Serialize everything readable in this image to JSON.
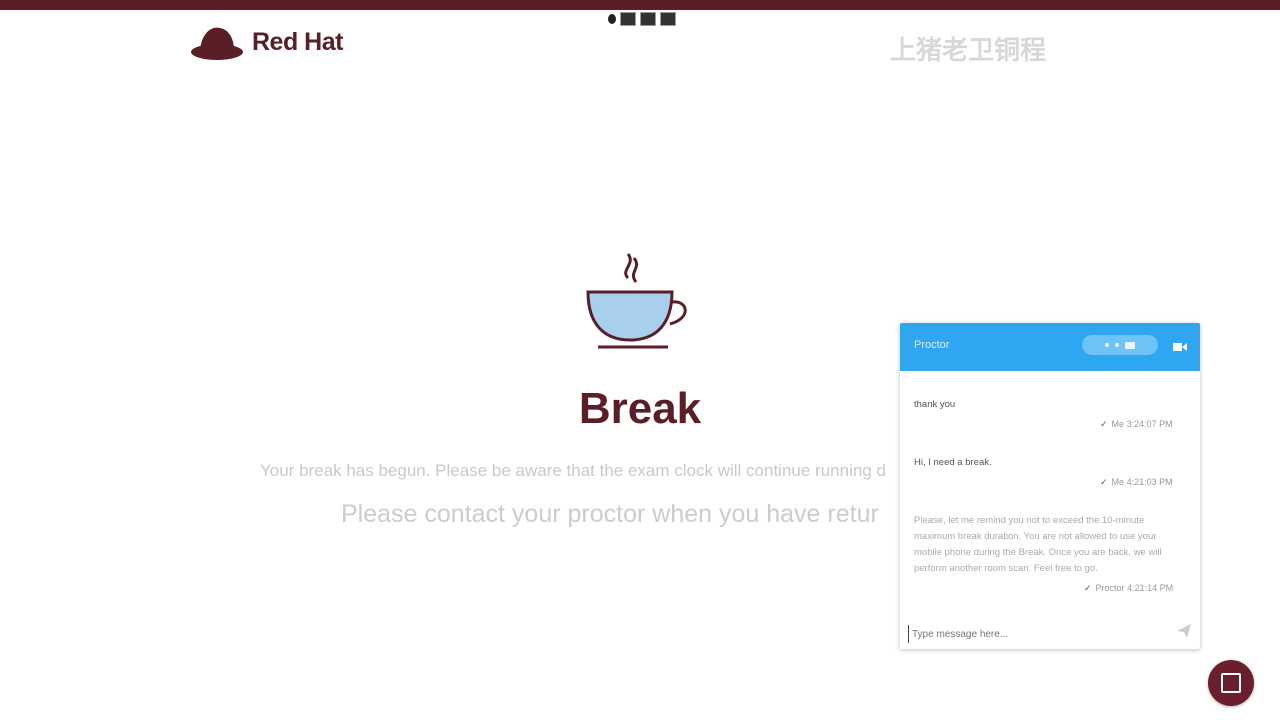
{
  "brand": {
    "name": "Red Hat"
  },
  "watermark": {
    "text": "上猪老卫铜程"
  },
  "break": {
    "title": "Break",
    "line1": "Your break has begun. Please be aware that the exam clock will continue running d",
    "line2": "Please contact your proctor when you have retur"
  },
  "chat": {
    "title": "Proctor",
    "messages": [
      {
        "text": "thank you",
        "sender": "Me",
        "time": "3:24:07 PM"
      },
      {
        "text": "Hi, I need a break.",
        "sender": "Me",
        "time": "4:21:03 PM"
      },
      {
        "text": "Please, let me remind you not to exceed the 10-minute maximum break duration. You are not allowed to use your mobile phone during the Break. Once you are back, we will perform another room scan. Feel free to go.",
        "sender": "Proctor",
        "time": "4:21:14 PM"
      }
    ],
    "input_placeholder": "Type message here..."
  },
  "colors": {
    "brand": "#5a1e26",
    "chat_header": "#2ea6f2",
    "cup": "#a8d0ec"
  },
  "icons": [
    "redhat-logo-icon",
    "coffee-cup-icon",
    "video-camera-icon",
    "send-icon",
    "check-icon",
    "chat-bubble-icon"
  ]
}
